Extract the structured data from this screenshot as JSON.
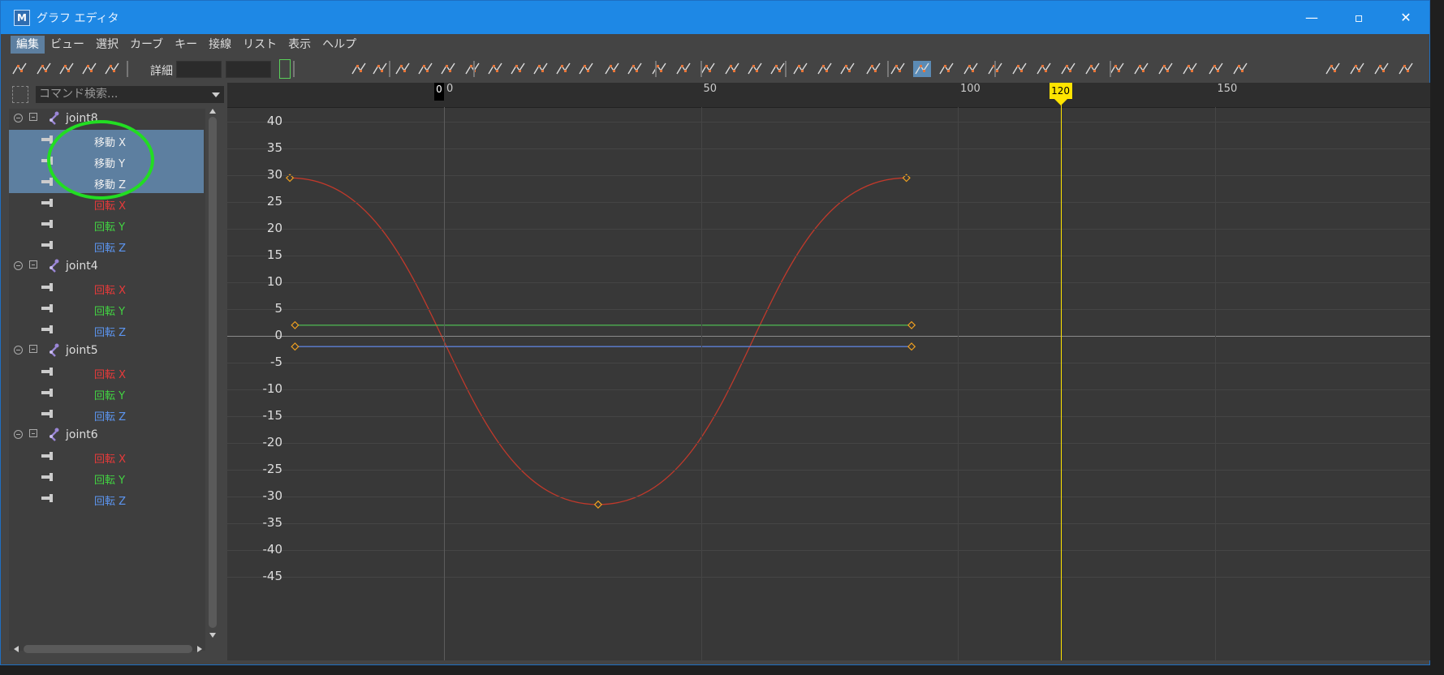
{
  "window": {
    "title": "グラフ エディタ",
    "app_icon": "M",
    "minimize": "—",
    "maximize": "▫",
    "close": "✕"
  },
  "menu": [
    "編集",
    "ビュー",
    "選択",
    "カーブ",
    "キー",
    "接線",
    "リスト",
    "表示",
    "ヘルプ"
  ],
  "toolbar": {
    "detail_label": "詳細"
  },
  "search": {
    "placeholder": "コマンド検索..."
  },
  "outliner": [
    {
      "type": "joint",
      "label": "joint8"
    },
    {
      "type": "attr",
      "label": "移動 X",
      "color": "white",
      "selected": true
    },
    {
      "type": "attr",
      "label": "移動 Y",
      "color": "white",
      "selected": true
    },
    {
      "type": "attr",
      "label": "移動 Z",
      "color": "white",
      "selected": true
    },
    {
      "type": "attr",
      "label": "回転 X",
      "color": "red"
    },
    {
      "type": "attr",
      "label": "回転 Y",
      "color": "green"
    },
    {
      "type": "attr",
      "label": "回転 Z",
      "color": "blue"
    },
    {
      "type": "joint",
      "label": "joint4"
    },
    {
      "type": "attr",
      "label": "回転 X",
      "color": "red"
    },
    {
      "type": "attr",
      "label": "回転 Y",
      "color": "green"
    },
    {
      "type": "attr",
      "label": "回転 Z",
      "color": "blue"
    },
    {
      "type": "joint",
      "label": "joint5"
    },
    {
      "type": "attr",
      "label": "回転 X",
      "color": "red"
    },
    {
      "type": "attr",
      "label": "回転 Y",
      "color": "green"
    },
    {
      "type": "attr",
      "label": "回転 Z",
      "color": "blue"
    },
    {
      "type": "joint",
      "label": "joint6"
    },
    {
      "type": "attr",
      "label": "回転 X",
      "color": "red"
    },
    {
      "type": "attr",
      "label": "回転 Y",
      "color": "green"
    },
    {
      "type": "attr",
      "label": "回転 Z",
      "color": "blue"
    }
  ],
  "graph": {
    "frame_ticks": [
      "0",
      "50",
      "100",
      "150"
    ],
    "current_frame": "120",
    "start_marker": "0",
    "y_ticks": [
      "40",
      "35",
      "30",
      "25",
      "20",
      "15",
      "10",
      "5",
      "0",
      "-5",
      "-10",
      "-15",
      "-20",
      "-25",
      "-30",
      "-35",
      "-40",
      "-45"
    ],
    "curves": [
      {
        "name": "rotate-x",
        "color": "#c0392b",
        "keys": [
          [
            -30,
            29.5
          ],
          [
            30,
            -31.5
          ],
          [
            90,
            29.5
          ]
        ]
      },
      {
        "name": "rotate-y",
        "color": "#4caf50",
        "keys": [
          [
            -29,
            2
          ],
          [
            91,
            2
          ]
        ]
      },
      {
        "name": "rotate-z",
        "color": "#5c7fd6",
        "keys": [
          [
            -29,
            -2
          ],
          [
            91,
            -2
          ]
        ]
      }
    ]
  },
  "colors": {
    "titlebar": "#1e88e5",
    "selection": "#5d7fa0",
    "time_marker": "#ffe400"
  }
}
